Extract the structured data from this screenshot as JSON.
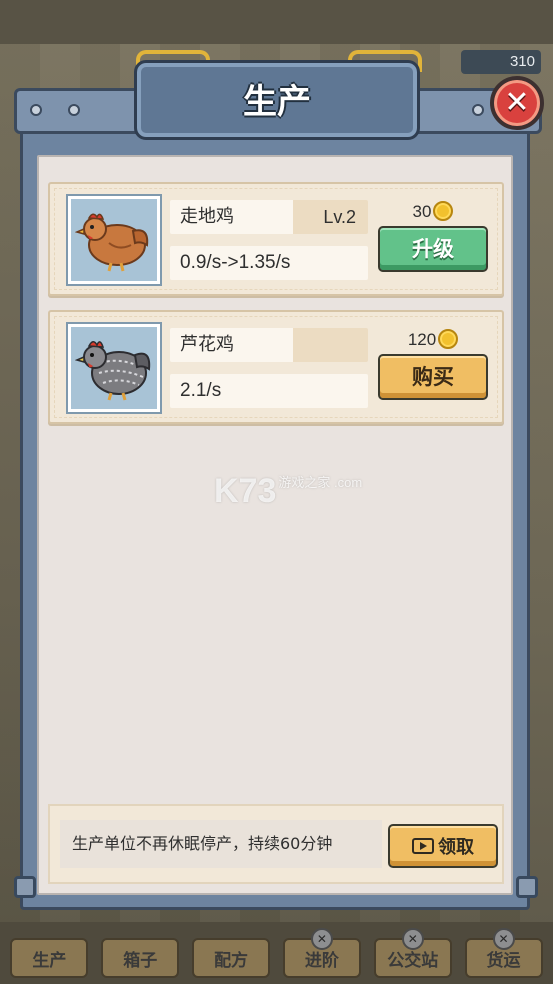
{
  "top_counter": "310",
  "dialog": {
    "title": "生产",
    "close_icon": "close-icon"
  },
  "items": [
    {
      "name": "走地鸡",
      "level": "Lv.2",
      "rate": "0.9/s->1.35/s",
      "price": "30",
      "action": "升级",
      "icon": "hen-icon",
      "action_color": "#62c28a"
    },
    {
      "name": "芦花鸡",
      "level": "",
      "rate": "2.1/s",
      "price": "120",
      "action": "购买",
      "icon": "gray-hen-icon",
      "action_color": "#f0be63"
    }
  ],
  "bonus": {
    "text": "生产单位不再休眠停产，持续60分钟",
    "claim_label": "领取",
    "claim_icon": "video-icon"
  },
  "watermark": {
    "main": "K73",
    "sub": "游戏之家 .com"
  },
  "bottom_nav": [
    "生产",
    "箱子",
    "配方",
    "进阶",
    "公交站",
    "货运"
  ]
}
